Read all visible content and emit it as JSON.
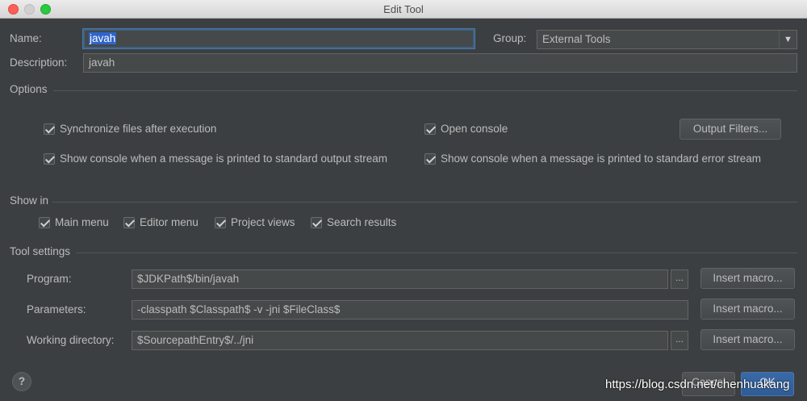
{
  "window": {
    "title": "Edit Tool"
  },
  "form": {
    "name_label": "Name:",
    "name_value": "javah",
    "group_label": "Group:",
    "group_value": "External Tools",
    "description_label": "Description:",
    "description_value": "javah"
  },
  "options": {
    "title": "Options",
    "sync_files": "Synchronize files after execution",
    "open_console": "Open console",
    "output_filters": "Output Filters...",
    "console_stdout": "Show console when a message is printed to standard output stream",
    "console_stderr": "Show console when a message is printed to standard error stream"
  },
  "show_in": {
    "title": "Show in",
    "main_menu": "Main menu",
    "editor_menu": "Editor menu",
    "project_views": "Project views",
    "search_results": "Search results"
  },
  "tool_settings": {
    "title": "Tool settings",
    "program_label": "Program:",
    "program_value": "$JDKPath$/bin/javah",
    "parameters_label": "Parameters:",
    "parameters_value": "-classpath $Classpath$ -v -jni $FileClass$",
    "workdir_label": "Working directory:",
    "workdir_value": "$SourcepathEntry$/../jni",
    "insert_macro": "Insert macro...",
    "browse": "..."
  },
  "footer": {
    "help": "?",
    "cancel": "Cancel",
    "ok": "OK",
    "watermark": "https://blog.csdn.net/chenhuakang"
  },
  "colors": {
    "accent": "#2f65ca",
    "background": "#3c3f41",
    "text": "#bbbbbb"
  }
}
